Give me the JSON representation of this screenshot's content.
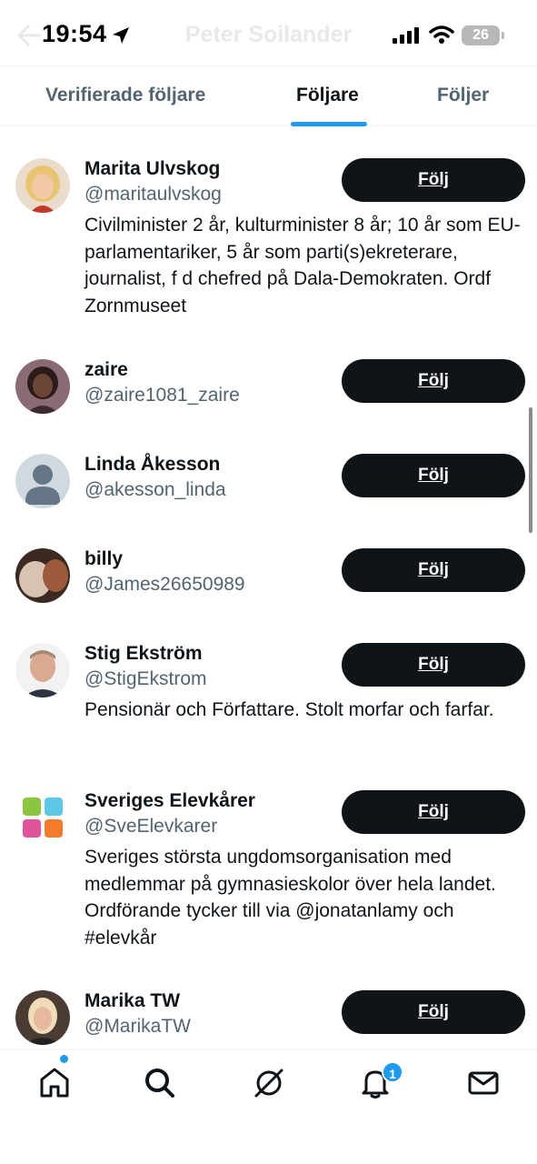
{
  "status_bar": {
    "time": "19:54",
    "battery": "26",
    "faded_title": "Peter Soilander"
  },
  "tabs": [
    {
      "label": "Verifierade följare",
      "active": false
    },
    {
      "label": "Följare",
      "active": true
    },
    {
      "label": "Följer",
      "active": false
    }
  ],
  "users": [
    {
      "name": "Marita Ulvskog",
      "handle": "@maritaulvskog",
      "bio": "Civilminister 2 år, kulturminister 8 år; 10 år som EU-parlamentariker, 5 år som parti(s)ekreterare, journalist, f d chefred på Dala-Demokraten. Ordf Zornmuseet",
      "button": "Följ"
    },
    {
      "name": "zaire",
      "handle": "@zaire1081_zaire",
      "bio": "",
      "button": "Följ"
    },
    {
      "name": "Linda Åkesson",
      "handle": "@akesson_linda",
      "bio": "",
      "button": "Följ"
    },
    {
      "name": "billy",
      "handle": "@James26650989",
      "bio": "",
      "button": "Följ"
    },
    {
      "name": "Stig Ekström",
      "handle": "@StigEkstrom",
      "bio": "Pensionär och Författare. Stolt morfar och farfar.",
      "button": "Följ"
    },
    {
      "name": "Sveriges Elevkårer",
      "handle": "@SveElevkarer",
      "bio": "Sveriges största ungdomsorganisation med medlemmar på gymnasieskolor över hela landet. Ordförande tycker till via @jonatanlamy och #elevkår",
      "button": "Följ"
    },
    {
      "name": "Marika TW",
      "handle": "@MarikaTW",
      "bio": "",
      "button": "Följ"
    }
  ],
  "bottom_nav": {
    "items": [
      "home-icon",
      "search-icon",
      "grok-icon",
      "bell-icon",
      "mail-icon"
    ],
    "notification_count": "1"
  },
  "colors": {
    "accent": "#1d9bf0",
    "button_bg": "#0f1419",
    "secondary_text": "#536471"
  }
}
